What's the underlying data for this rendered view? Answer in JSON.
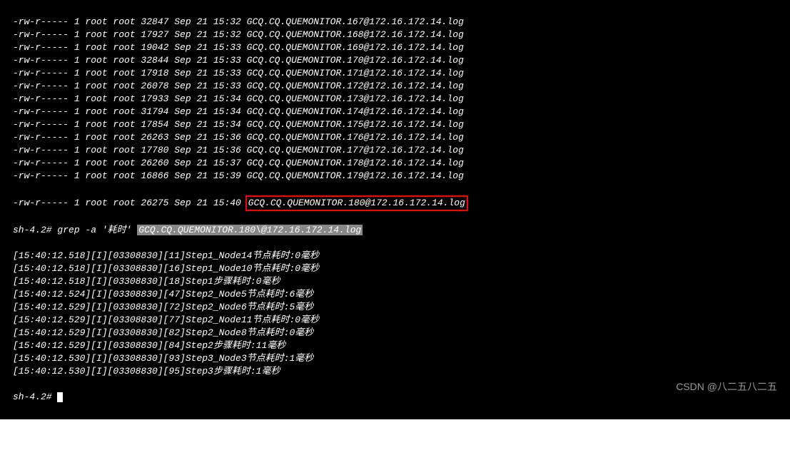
{
  "ls_entries": [
    {
      "perms": "-rw-r-----",
      "links": "1",
      "owner": "root",
      "group": "root",
      "size": "32847",
      "month": "Sep",
      "day": "21",
      "time": "15:32",
      "name": "GCQ.CQ.QUEMONITOR.167@172.16.172.14.log"
    },
    {
      "perms": "-rw-r-----",
      "links": "1",
      "owner": "root",
      "group": "root",
      "size": "17927",
      "month": "Sep",
      "day": "21",
      "time": "15:32",
      "name": "GCQ.CQ.QUEMONITOR.168@172.16.172.14.log"
    },
    {
      "perms": "-rw-r-----",
      "links": "1",
      "owner": "root",
      "group": "root",
      "size": "19042",
      "month": "Sep",
      "day": "21",
      "time": "15:33",
      "name": "GCQ.CQ.QUEMONITOR.169@172.16.172.14.log"
    },
    {
      "perms": "-rw-r-----",
      "links": "1",
      "owner": "root",
      "group": "root",
      "size": "32844",
      "month": "Sep",
      "day": "21",
      "time": "15:33",
      "name": "GCQ.CQ.QUEMONITOR.170@172.16.172.14.log"
    },
    {
      "perms": "-rw-r-----",
      "links": "1",
      "owner": "root",
      "group": "root",
      "size": "17918",
      "month": "Sep",
      "day": "21",
      "time": "15:33",
      "name": "GCQ.CQ.QUEMONITOR.171@172.16.172.14.log"
    },
    {
      "perms": "-rw-r-----",
      "links": "1",
      "owner": "root",
      "group": "root",
      "size": "26078",
      "month": "Sep",
      "day": "21",
      "time": "15:33",
      "name": "GCQ.CQ.QUEMONITOR.172@172.16.172.14.log"
    },
    {
      "perms": "-rw-r-----",
      "links": "1",
      "owner": "root",
      "group": "root",
      "size": "17933",
      "month": "Sep",
      "day": "21",
      "time": "15:34",
      "name": "GCQ.CQ.QUEMONITOR.173@172.16.172.14.log"
    },
    {
      "perms": "-rw-r-----",
      "links": "1",
      "owner": "root",
      "group": "root",
      "size": "31794",
      "month": "Sep",
      "day": "21",
      "time": "15:34",
      "name": "GCQ.CQ.QUEMONITOR.174@172.16.172.14.log"
    },
    {
      "perms": "-rw-r-----",
      "links": "1",
      "owner": "root",
      "group": "root",
      "size": "17854",
      "month": "Sep",
      "day": "21",
      "time": "15:34",
      "name": "GCQ.CQ.QUEMONITOR.175@172.16.172.14.log"
    },
    {
      "perms": "-rw-r-----",
      "links": "1",
      "owner": "root",
      "group": "root",
      "size": "26263",
      "month": "Sep",
      "day": "21",
      "time": "15:36",
      "name": "GCQ.CQ.QUEMONITOR.176@172.16.172.14.log"
    },
    {
      "perms": "-rw-r-----",
      "links": "1",
      "owner": "root",
      "group": "root",
      "size": "17780",
      "month": "Sep",
      "day": "21",
      "time": "15:36",
      "name": "GCQ.CQ.QUEMONITOR.177@172.16.172.14.log"
    },
    {
      "perms": "-rw-r-----",
      "links": "1",
      "owner": "root",
      "group": "root",
      "size": "26260",
      "month": "Sep",
      "day": "21",
      "time": "15:37",
      "name": "GCQ.CQ.QUEMONITOR.178@172.16.172.14.log"
    },
    {
      "perms": "-rw-r-----",
      "links": "1",
      "owner": "root",
      "group": "root",
      "size": "16866",
      "month": "Sep",
      "day": "21",
      "time": "15:39",
      "name": "GCQ.CQ.QUEMONITOR.179@172.16.172.14.log"
    }
  ],
  "highlighted_entry": {
    "perms": "-rw-r-----",
    "links": "1",
    "owner": "root",
    "group": "root",
    "size": "26275",
    "month": "Sep",
    "day": "21",
    "time": "15:40",
    "name": "GCQ.CQ.QUEMONITOR.180@172.16.172.14.log"
  },
  "prompt1": "sh-4.2# ",
  "grep_cmd_prefix": "grep -a '耗时' ",
  "grep_cmd_file": "GCQ.CQ.QUEMONITOR.180\\@172.16.172.14.log",
  "grep_output": [
    "[15:40:12.518][I][03308830][11]Step1_Node14节点耗时:0毫秒",
    "[15:40:12.518][I][03308830][16]Step1_Node10节点耗时:0毫秒",
    "[15:40:12.518][I][03308830][18]Step1步骤耗时:0毫秒",
    "[15:40:12.524][I][03308830][47]Step2_Node5节点耗时:6毫秒",
    "[15:40:12.529][I][03308830][72]Step2_Node6节点耗时:5毫秒",
    "[15:40:12.529][I][03308830][77]Step2_Node11节点耗时:0毫秒",
    "[15:40:12.529][I][03308830][82]Step2_Node8节点耗时:0毫秒",
    "[15:40:12.529][I][03308830][84]Step2步骤耗时:11毫秒",
    "[15:40:12.530][I][03308830][93]Step3_Node3节点耗时:1毫秒",
    "[15:40:12.530][I][03308830][95]Step3步骤耗时:1毫秒"
  ],
  "prompt2": "sh-4.2# ",
  "watermark": "CSDN @八二五八二五"
}
